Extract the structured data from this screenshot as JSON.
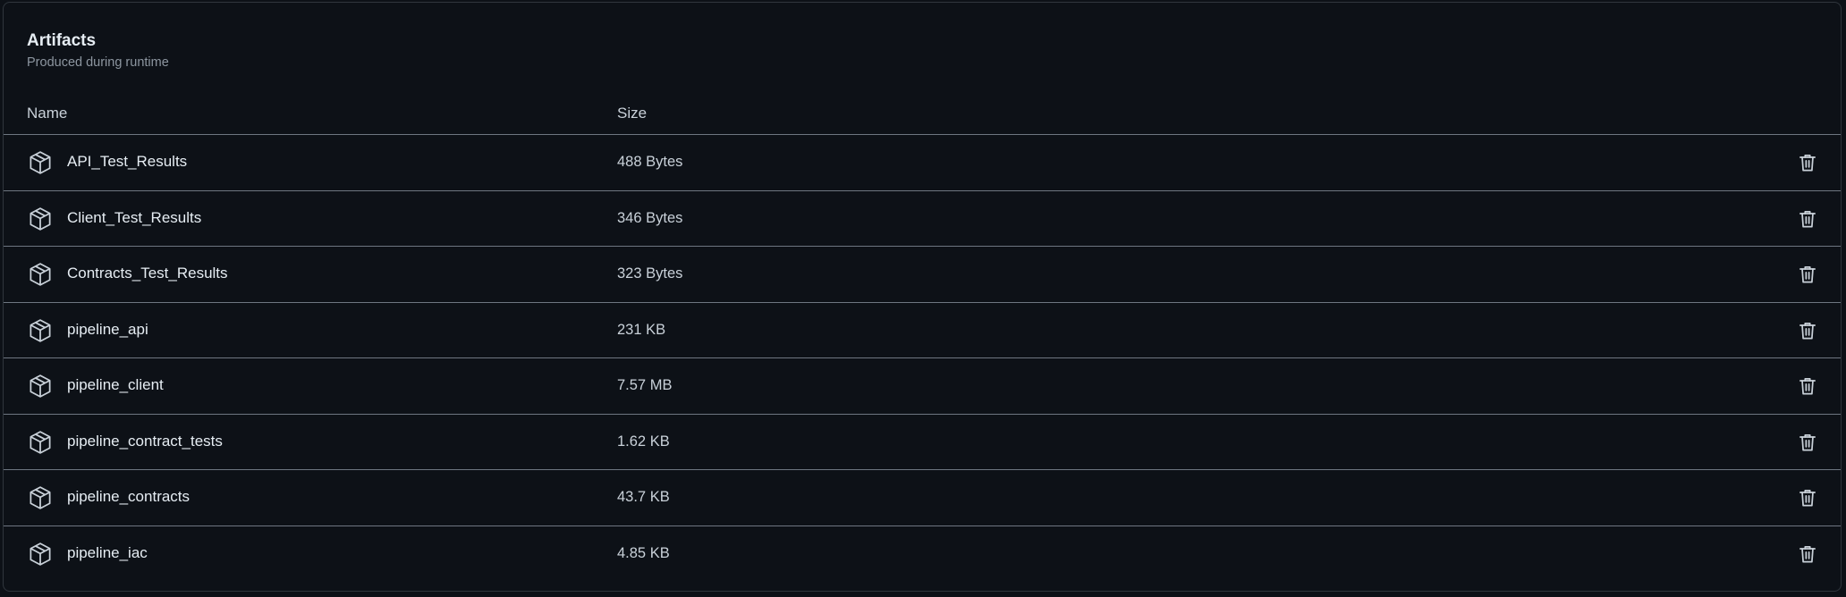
{
  "panel": {
    "title": "Artifacts",
    "subtitle": "Produced during runtime"
  },
  "columns": {
    "name": "Name",
    "size": "Size"
  },
  "artifacts": [
    {
      "name": "API_Test_Results",
      "size": "488 Bytes"
    },
    {
      "name": "Client_Test_Results",
      "size": "346 Bytes"
    },
    {
      "name": "Contracts_Test_Results",
      "size": "323 Bytes"
    },
    {
      "name": "pipeline_api",
      "size": "231 KB"
    },
    {
      "name": "pipeline_client",
      "size": "7.57 MB"
    },
    {
      "name": "pipeline_contract_tests",
      "size": "1.62 KB"
    },
    {
      "name": "pipeline_contracts",
      "size": "43.7 KB"
    },
    {
      "name": "pipeline_iac",
      "size": "4.85 KB"
    }
  ],
  "icons": {
    "row_icon": "package-icon",
    "delete_icon": "trash-icon"
  },
  "colors": {
    "background": "#0d1117",
    "border": "#30363d",
    "text": "#e6edf3",
    "muted": "#8d96a0"
  }
}
